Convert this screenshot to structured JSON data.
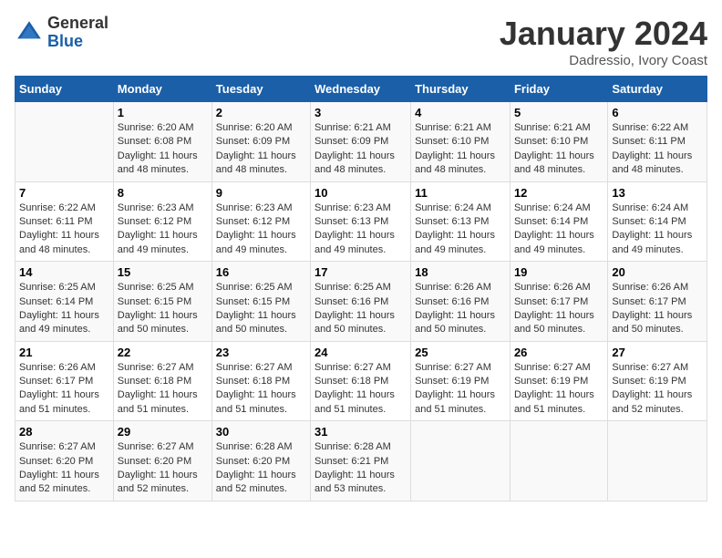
{
  "header": {
    "logo_general": "General",
    "logo_blue": "Blue",
    "month_title": "January 2024",
    "location": "Dadressio, Ivory Coast"
  },
  "days_of_week": [
    "Sunday",
    "Monday",
    "Tuesday",
    "Wednesday",
    "Thursday",
    "Friday",
    "Saturday"
  ],
  "weeks": [
    [
      {
        "day": "",
        "info": ""
      },
      {
        "day": "1",
        "info": "Sunrise: 6:20 AM\nSunset: 6:08 PM\nDaylight: 11 hours and 48 minutes."
      },
      {
        "day": "2",
        "info": "Sunrise: 6:20 AM\nSunset: 6:09 PM\nDaylight: 11 hours and 48 minutes."
      },
      {
        "day": "3",
        "info": "Sunrise: 6:21 AM\nSunset: 6:09 PM\nDaylight: 11 hours and 48 minutes."
      },
      {
        "day": "4",
        "info": "Sunrise: 6:21 AM\nSunset: 6:10 PM\nDaylight: 11 hours and 48 minutes."
      },
      {
        "day": "5",
        "info": "Sunrise: 6:21 AM\nSunset: 6:10 PM\nDaylight: 11 hours and 48 minutes."
      },
      {
        "day": "6",
        "info": "Sunrise: 6:22 AM\nSunset: 6:11 PM\nDaylight: 11 hours and 48 minutes."
      }
    ],
    [
      {
        "day": "7",
        "info": "Sunrise: 6:22 AM\nSunset: 6:11 PM\nDaylight: 11 hours and 48 minutes."
      },
      {
        "day": "8",
        "info": "Sunrise: 6:23 AM\nSunset: 6:12 PM\nDaylight: 11 hours and 49 minutes."
      },
      {
        "day": "9",
        "info": "Sunrise: 6:23 AM\nSunset: 6:12 PM\nDaylight: 11 hours and 49 minutes."
      },
      {
        "day": "10",
        "info": "Sunrise: 6:23 AM\nSunset: 6:13 PM\nDaylight: 11 hours and 49 minutes."
      },
      {
        "day": "11",
        "info": "Sunrise: 6:24 AM\nSunset: 6:13 PM\nDaylight: 11 hours and 49 minutes."
      },
      {
        "day": "12",
        "info": "Sunrise: 6:24 AM\nSunset: 6:14 PM\nDaylight: 11 hours and 49 minutes."
      },
      {
        "day": "13",
        "info": "Sunrise: 6:24 AM\nSunset: 6:14 PM\nDaylight: 11 hours and 49 minutes."
      }
    ],
    [
      {
        "day": "14",
        "info": "Sunrise: 6:25 AM\nSunset: 6:14 PM\nDaylight: 11 hours and 49 minutes."
      },
      {
        "day": "15",
        "info": "Sunrise: 6:25 AM\nSunset: 6:15 PM\nDaylight: 11 hours and 50 minutes."
      },
      {
        "day": "16",
        "info": "Sunrise: 6:25 AM\nSunset: 6:15 PM\nDaylight: 11 hours and 50 minutes."
      },
      {
        "day": "17",
        "info": "Sunrise: 6:25 AM\nSunset: 6:16 PM\nDaylight: 11 hours and 50 minutes."
      },
      {
        "day": "18",
        "info": "Sunrise: 6:26 AM\nSunset: 6:16 PM\nDaylight: 11 hours and 50 minutes."
      },
      {
        "day": "19",
        "info": "Sunrise: 6:26 AM\nSunset: 6:17 PM\nDaylight: 11 hours and 50 minutes."
      },
      {
        "day": "20",
        "info": "Sunrise: 6:26 AM\nSunset: 6:17 PM\nDaylight: 11 hours and 50 minutes."
      }
    ],
    [
      {
        "day": "21",
        "info": "Sunrise: 6:26 AM\nSunset: 6:17 PM\nDaylight: 11 hours and 51 minutes."
      },
      {
        "day": "22",
        "info": "Sunrise: 6:27 AM\nSunset: 6:18 PM\nDaylight: 11 hours and 51 minutes."
      },
      {
        "day": "23",
        "info": "Sunrise: 6:27 AM\nSunset: 6:18 PM\nDaylight: 11 hours and 51 minutes."
      },
      {
        "day": "24",
        "info": "Sunrise: 6:27 AM\nSunset: 6:18 PM\nDaylight: 11 hours and 51 minutes."
      },
      {
        "day": "25",
        "info": "Sunrise: 6:27 AM\nSunset: 6:19 PM\nDaylight: 11 hours and 51 minutes."
      },
      {
        "day": "26",
        "info": "Sunrise: 6:27 AM\nSunset: 6:19 PM\nDaylight: 11 hours and 51 minutes."
      },
      {
        "day": "27",
        "info": "Sunrise: 6:27 AM\nSunset: 6:19 PM\nDaylight: 11 hours and 52 minutes."
      }
    ],
    [
      {
        "day": "28",
        "info": "Sunrise: 6:27 AM\nSunset: 6:20 PM\nDaylight: 11 hours and 52 minutes."
      },
      {
        "day": "29",
        "info": "Sunrise: 6:27 AM\nSunset: 6:20 PM\nDaylight: 11 hours and 52 minutes."
      },
      {
        "day": "30",
        "info": "Sunrise: 6:28 AM\nSunset: 6:20 PM\nDaylight: 11 hours and 52 minutes."
      },
      {
        "day": "31",
        "info": "Sunrise: 6:28 AM\nSunset: 6:21 PM\nDaylight: 11 hours and 53 minutes."
      },
      {
        "day": "",
        "info": ""
      },
      {
        "day": "",
        "info": ""
      },
      {
        "day": "",
        "info": ""
      }
    ]
  ]
}
